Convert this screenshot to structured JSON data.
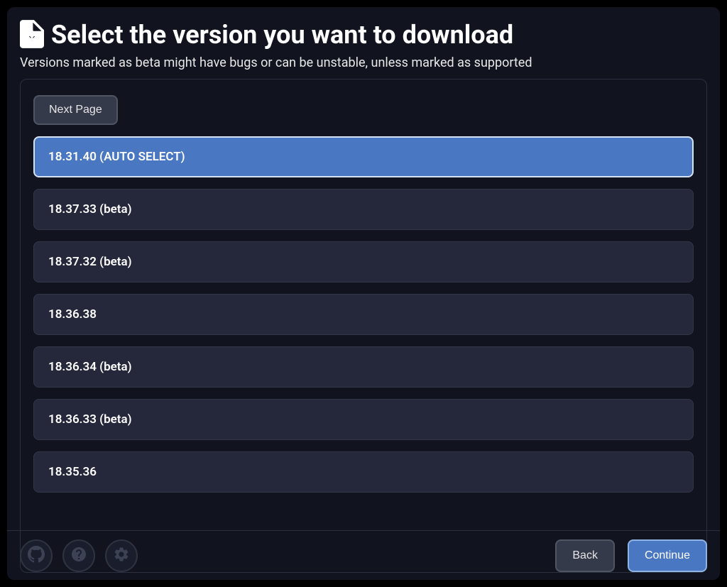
{
  "header": {
    "title": "Select the version you want to download",
    "subtitle": "Versions marked as beta might have bugs or can be unstable, unless marked as supported"
  },
  "pager": {
    "next_label": "Next Page"
  },
  "versions": [
    {
      "label": "18.31.40 (AUTO SELECT)",
      "selected": true
    },
    {
      "label": "18.37.33 (beta)",
      "selected": false
    },
    {
      "label": "18.37.32 (beta)",
      "selected": false
    },
    {
      "label": "18.36.38",
      "selected": false
    },
    {
      "label": "18.36.34 (beta)",
      "selected": false
    },
    {
      "label": "18.36.33 (beta)",
      "selected": false
    },
    {
      "label": "18.35.36",
      "selected": false
    }
  ],
  "footer": {
    "back_label": "Back",
    "continue_label": "Continue",
    "icons": {
      "github": "github-icon",
      "help": "help-icon",
      "settings": "gear-icon"
    }
  }
}
